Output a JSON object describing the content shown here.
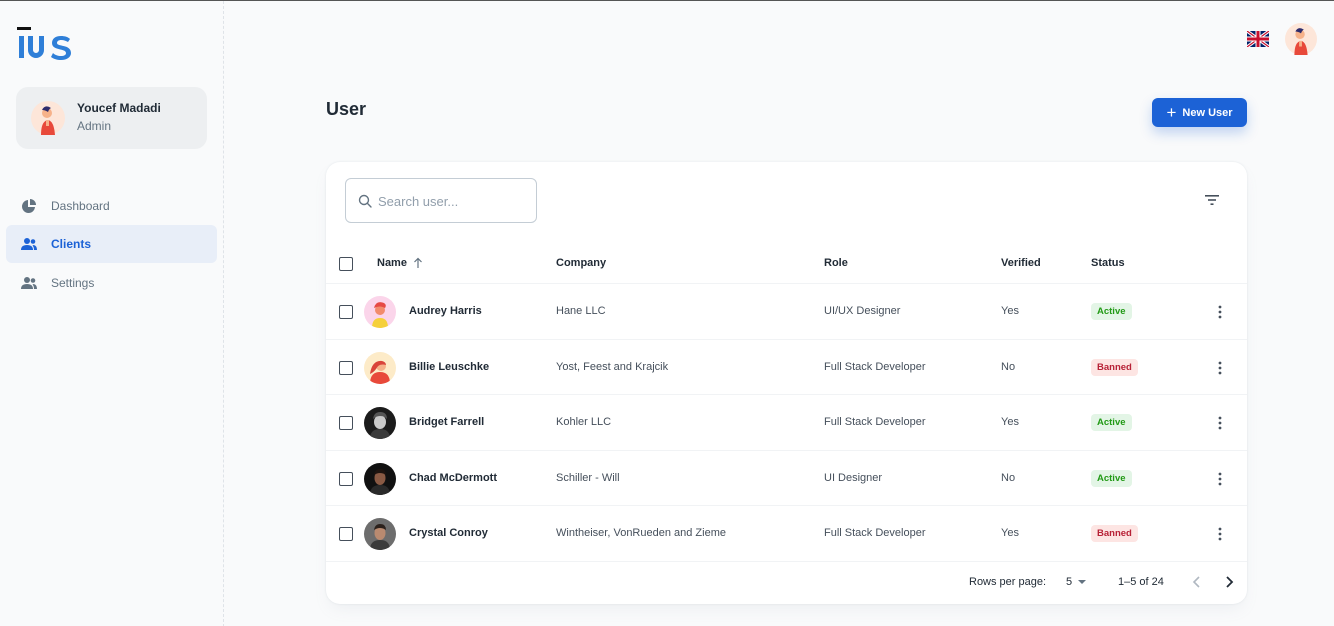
{
  "brand": {
    "logo_text": "iUS"
  },
  "account": {
    "name": "Youcef Madadi",
    "role": "Admin"
  },
  "nav": [
    {
      "label": "Dashboard",
      "icon": "pie-chart-icon",
      "active": false
    },
    {
      "label": "Clients",
      "icon": "people-icon",
      "active": true
    },
    {
      "label": "Settings",
      "icon": "people-icon",
      "active": false
    }
  ],
  "header": {
    "language_icon": "uk-flag-icon"
  },
  "page": {
    "title": "User",
    "new_user_label": "New User"
  },
  "search": {
    "placeholder": "Search user...",
    "value": ""
  },
  "table": {
    "columns": {
      "name": "Name",
      "company": "Company",
      "role": "Role",
      "verified": "Verified",
      "status": "Status"
    },
    "sort": {
      "column": "Name",
      "direction": "asc"
    },
    "rows": [
      {
        "name": "Audrey Harris",
        "company": "Hane LLC",
        "role": "UI/UX Designer",
        "verified": "Yes",
        "status": "Active"
      },
      {
        "name": "Billie Leuschke",
        "company": "Yost, Feest and Krajcik",
        "role": "Full Stack Developer",
        "verified": "No",
        "status": "Banned"
      },
      {
        "name": "Bridget Farrell",
        "company": "Kohler LLC",
        "role": "Full Stack Developer",
        "verified": "Yes",
        "status": "Active"
      },
      {
        "name": "Chad McDermott",
        "company": "Schiller - Will",
        "role": "UI Designer",
        "verified": "No",
        "status": "Active"
      },
      {
        "name": "Crystal Conroy",
        "company": "Wintheiser, VonRueden and Zieme",
        "role": "Full Stack Developer",
        "verified": "Yes",
        "status": "Banned"
      }
    ]
  },
  "pagination": {
    "rows_per_page_label": "Rows per page:",
    "rows_per_page": "5",
    "range": "1–5 of 24"
  },
  "colors": {
    "primary": "#1c62d6",
    "active_bg": "#e3f5e6",
    "active_text": "#229a16",
    "banned_bg": "#fde5e3",
    "banned_text": "#b72136"
  }
}
